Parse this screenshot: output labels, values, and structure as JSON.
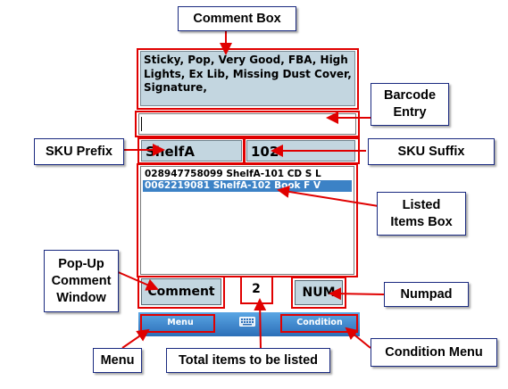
{
  "comment_box": {
    "text": "Sticky, Pop, Very Good, FBA, High Lights, Ex Lib, Missing Dust Cover, Signature,"
  },
  "barcode_entry": {
    "value": "",
    "placeholder": ""
  },
  "sku": {
    "prefix": "ShelfA",
    "suffix": "102"
  },
  "items": [
    {
      "text": "028947758099 ShelfA-101 CD S L",
      "selected": false
    },
    {
      "text": "0062219081 ShelfA-102 Book F V",
      "selected": true
    }
  ],
  "buttons": {
    "comment": "Comment",
    "num": "NUM"
  },
  "total_count": "2",
  "menu_bar": {
    "left": "Menu",
    "right": "Condition",
    "center_icon": "keyboard-icon"
  },
  "callouts": {
    "comment_box": "Comment Box",
    "barcode_entry_line1": "Barcode",
    "barcode_entry_line2": "Entry",
    "sku_prefix": "SKU Prefix",
    "sku_suffix": "SKU Suffix",
    "listed_items_line1": "Listed",
    "listed_items_line2": "Items Box",
    "popup_line1": "Pop-Up",
    "popup_line2": "Comment",
    "popup_line3": "Window",
    "numpad": "Numpad",
    "menu": "Menu",
    "total_items": "Total items to be listed",
    "condition_menu": "Condition Menu"
  },
  "colors": {
    "field_bg": "#c3d6e0",
    "selection": "#3c82c6",
    "annotation_red": "#e00000",
    "callout_border": "#1a2a80",
    "menu_bar_top": "#5aa6e4",
    "menu_bar_bottom": "#2c6fb8"
  }
}
